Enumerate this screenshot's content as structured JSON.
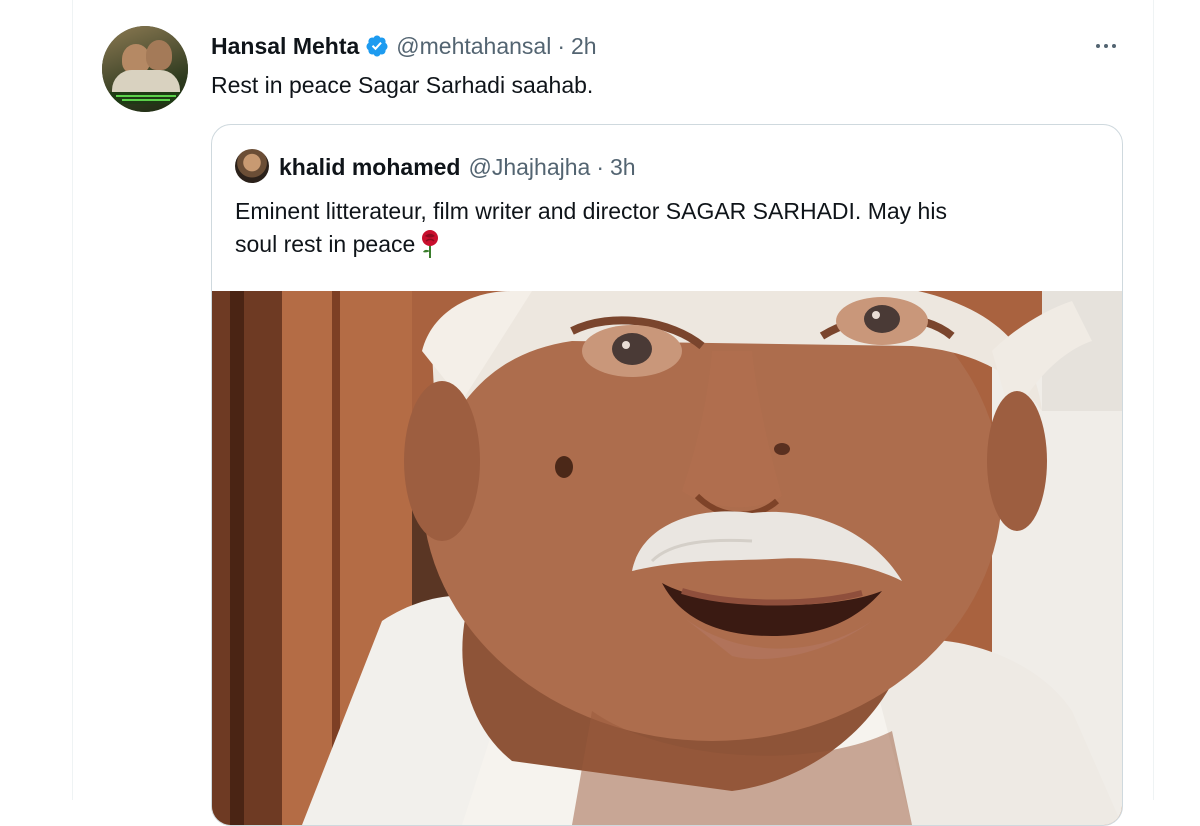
{
  "tweet": {
    "display_name": "Hansal Mehta",
    "handle": "@mehtahansal",
    "separator": "·",
    "time": "2h",
    "text": "Rest in peace Sagar Sarhadi saahab.",
    "verified": true,
    "more_icon": "more-horizontal-icon"
  },
  "quoted_tweet": {
    "display_name": "khalid mohamed",
    "handle": "@Jhajhajha",
    "separator": "·",
    "time": "3h",
    "text_line1": "Eminent litterateur, film writer and director SAGAR SARHADI. May his",
    "text_line2": "soul rest in peace",
    "emoji": "rose-icon",
    "media": "photo-of-elderly-man-white-mustache"
  },
  "colors": {
    "text_primary": "#0f1419",
    "text_secondary": "#536471",
    "verified_blue": "#1d9bf0",
    "border": "#cfd9de"
  }
}
